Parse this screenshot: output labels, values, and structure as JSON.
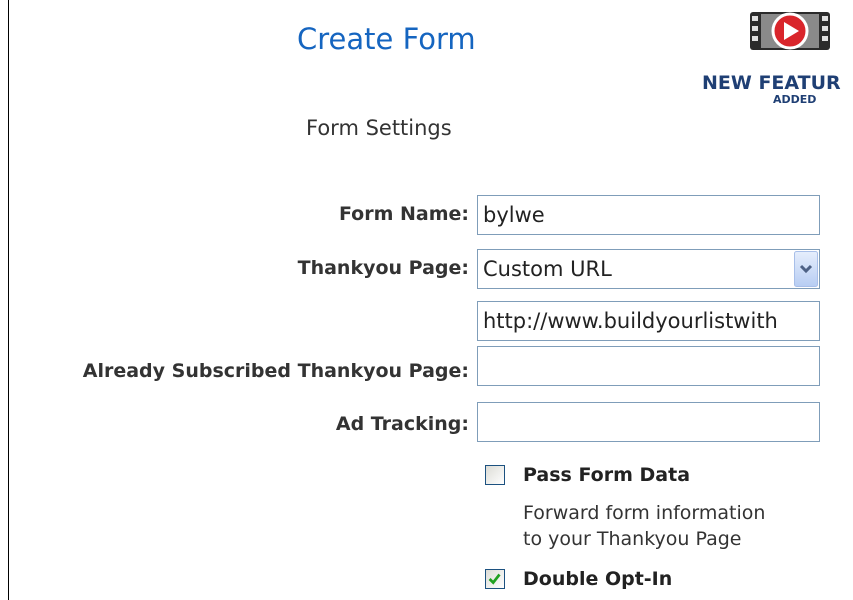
{
  "header": {
    "title": "Create Form",
    "badge_line1": "NEW FEATUR",
    "badge_line2": "ADDED",
    "subtitle": "Form Settings"
  },
  "fields": {
    "form_name_label": "Form Name:",
    "form_name_value": "bylwe",
    "thankyou_label": "Thankyou Page:",
    "thankyou_selected": "Custom URL",
    "thankyou_url": "http://www.buildyourlistwith",
    "already_subscribed_label": "Already Subscribed Thankyou Page:",
    "already_subscribed_value": "",
    "ad_tracking_label": "Ad Tracking:",
    "ad_tracking_value": ""
  },
  "options": {
    "pass_form_data_label": "Pass Form Data",
    "pass_form_data_checked": false,
    "pass_form_data_help_line1": "Forward form information",
    "pass_form_data_help_line2": "to your Thankyou Page",
    "double_optin_label": "Double Opt-In",
    "double_optin_checked": true
  },
  "colors": {
    "title": "#1565c0",
    "badge_text": "#1f3f74",
    "field_border": "#7f9db9",
    "checkmark": "#21a121"
  },
  "icons": {
    "badge": "video-film-play-icon",
    "dropdown": "chevron-down-icon",
    "checkmark": "checkmark-icon"
  }
}
